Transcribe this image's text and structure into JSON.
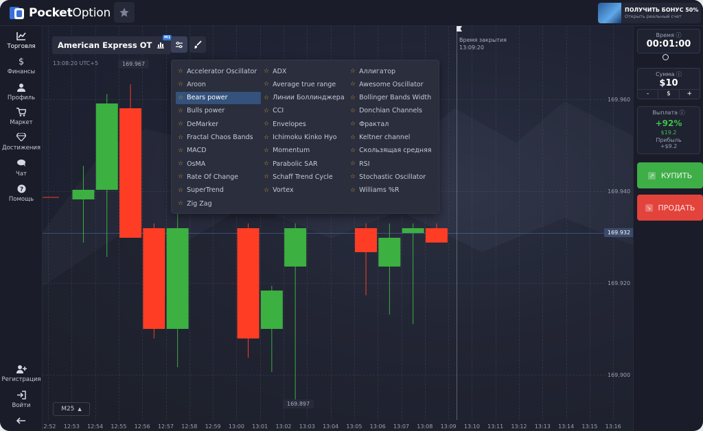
{
  "app": {
    "brand_bold": "Pocket",
    "brand_light": "Option",
    "bonus_title": "ПОЛУЧИТЬ БОНУС 50%",
    "bonus_sub": "Открыть реальный счет"
  },
  "sidebar": {
    "top": [
      {
        "label": "Торговля",
        "icon": "chart-icon"
      },
      {
        "label": "Финансы",
        "icon": "dollar-icon"
      },
      {
        "label": "Профиль",
        "icon": "user-icon"
      },
      {
        "label": "Маркет",
        "icon": "cart-icon"
      },
      {
        "label": "Достижения",
        "icon": "diamond-icon"
      },
      {
        "label": "Чат",
        "icon": "chat-icon"
      },
      {
        "label": "Помощь",
        "icon": "help-icon"
      }
    ],
    "bottom": [
      {
        "label": "Регистрация",
        "icon": "add-user-icon"
      },
      {
        "label": "Войти",
        "icon": "login-icon"
      }
    ]
  },
  "chart": {
    "asset": "American Express OTC",
    "timeframe_badge": "M1",
    "time_display": "13:08:20 UTC+5",
    "high_tag": "169.967",
    "low_tag": "169.897",
    "current_price": "169.932",
    "close_label": "Время закрытия",
    "close_time": "13:09:20",
    "timeframe_btn": "M25",
    "y_ticks": [
      "169.960",
      "169.940",
      "169.920",
      "169.900"
    ],
    "x_ticks": [
      "12:52",
      "12:53",
      "12:54",
      "12:55",
      "12:56",
      "12:57",
      "12:58",
      "12:59",
      "13:00",
      "13:01",
      "13:02",
      "13:03",
      "13:04",
      "13:05",
      "13:06",
      "13:07",
      "13:08",
      "13:09",
      "13:10",
      "13:11",
      "13:12",
      "13:13",
      "13:14",
      "13:15",
      "13:16"
    ],
    "colors": {
      "up": "#3cb041",
      "down": "#ff3d25"
    }
  },
  "chart_data": {
    "type": "candlestick",
    "x": [
      "12:53",
      "12:54",
      "12:55",
      "12:56",
      "12:57",
      "13:00",
      "13:01",
      "13:02",
      "13:05",
      "13:06",
      "13:07",
      "13:08"
    ],
    "ylim": [
      169.895,
      169.97
    ],
    "candles": [
      {
        "t": "12:53",
        "open": 169.941,
        "close": 169.943,
        "high": 169.948,
        "low": 169.932
      },
      {
        "t": "12:54",
        "open": 169.943,
        "close": 169.961,
        "high": 169.963,
        "low": 169.929
      },
      {
        "t": "12:55",
        "open": 169.96,
        "close": 169.933,
        "high": 169.965,
        "low": 169.941
      },
      {
        "t": "12:56",
        "open": 169.935,
        "close": 169.914,
        "high": 169.936,
        "low": 169.912
      },
      {
        "t": "12:57",
        "open": 169.914,
        "close": 169.935,
        "high": 169.938,
        "low": 169.906
      },
      {
        "t": "13:00",
        "open": 169.935,
        "close": 169.912,
        "high": 169.936,
        "low": 169.908
      },
      {
        "t": "13:01",
        "open": 169.914,
        "close": 169.922,
        "high": 169.923,
        "low": 169.905
      },
      {
        "t": "13:02",
        "open": 169.927,
        "close": 169.935,
        "high": 169.936,
        "low": 169.898
      },
      {
        "t": "13:05",
        "open": 169.935,
        "close": 169.93,
        "high": 169.936,
        "low": 169.921
      },
      {
        "t": "13:06",
        "open": 169.927,
        "close": 169.933,
        "high": 169.936,
        "low": 169.917
      },
      {
        "t": "13:07",
        "open": 169.934,
        "close": 169.935,
        "high": 169.936,
        "low": 169.915
      },
      {
        "t": "13:08",
        "open": 169.935,
        "close": 169.932,
        "high": 169.936,
        "low": 169.932
      }
    ]
  },
  "indicators": {
    "columns": [
      [
        "Accelerator Oscillator",
        "Aroon",
        "Bears power",
        "Bulls power",
        "DeMarker",
        "Fractal Chaos Bands",
        "MACD",
        "OsMA",
        "Rate Of Change",
        "SuperTrend",
        "Zig Zag"
      ],
      [
        "ADX",
        "Average true range",
        "Линии Боллинджера",
        "CCI",
        "Envelopes",
        "Ichimoku Kinko Hyo",
        "Momentum",
        "Parabolic SAR",
        "Schaff Trend Cycle",
        "Vortex"
      ],
      [
        "Аллигатор",
        "Awesome Oscillator",
        "Bollinger Bands Width",
        "Donchian Channels",
        "Фрактал",
        "Keltner channel",
        "Скользящая средняя",
        "RSI",
        "Stochastic Oscillator",
        "Williams %R"
      ]
    ],
    "selected": "Bears power"
  },
  "panel": {
    "time_title": "Время",
    "time_value": "00:01:00",
    "amount_title": "Сумма",
    "amount_value": "$10",
    "amount_minus": "-",
    "amount_currency": "$",
    "amount_plus": "+",
    "payout_title": "Выплата",
    "payout_pct": "+92%",
    "payout_sum": "$19.2",
    "profit_title": "Прибыль",
    "profit_value": "+$9.2",
    "buy_label": "КУПИТЬ",
    "sell_label": "ПРОДАТЬ"
  }
}
